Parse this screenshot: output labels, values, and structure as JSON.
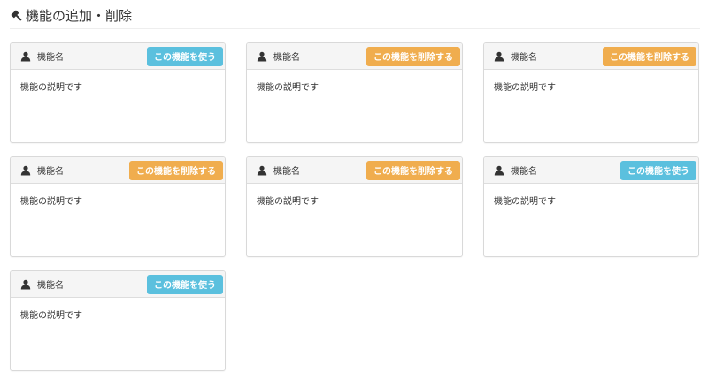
{
  "header": {
    "title": "機能の追加・削除",
    "icon": "gavel-icon"
  },
  "colors": {
    "use_button": "#5bc0de",
    "delete_button": "#f0ad4e",
    "panel_heading_bg": "#f5f5f5"
  },
  "features": [
    {
      "name": "機能名",
      "description": "機能の説明です",
      "action_label": "この機能を使う",
      "action": "use",
      "icon": "user-icon"
    },
    {
      "name": "機能名",
      "description": "機能の説明です",
      "action_label": "この機能を削除する",
      "action": "delete",
      "icon": "user-icon"
    },
    {
      "name": "機能名",
      "description": "機能の説明です",
      "action_label": "この機能を削除する",
      "action": "delete",
      "icon": "user-icon"
    },
    {
      "name": "機能名",
      "description": "機能の説明です",
      "action_label": "この機能を削除する",
      "action": "delete",
      "icon": "user-icon"
    },
    {
      "name": "機能名",
      "description": "機能の説明です",
      "action_label": "この機能を削除する",
      "action": "delete",
      "icon": "user-icon"
    },
    {
      "name": "機能名",
      "description": "機能の説明です",
      "action_label": "この機能を使う",
      "action": "use",
      "icon": "user-icon"
    },
    {
      "name": "機能名",
      "description": "機能の説明です",
      "action_label": "この機能を使う",
      "action": "use",
      "icon": "user-icon"
    }
  ]
}
